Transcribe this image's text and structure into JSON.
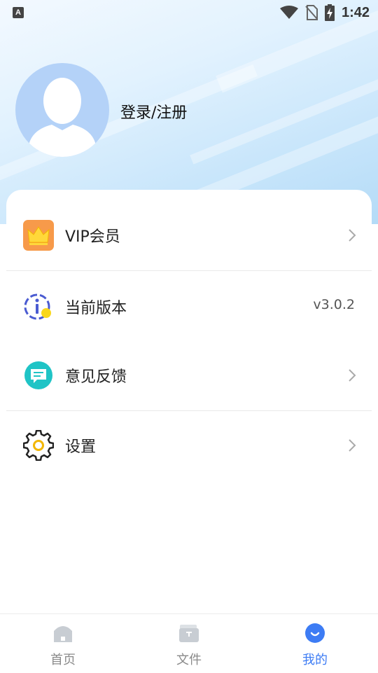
{
  "status_bar": {
    "time": "1:42",
    "app_icon": "A"
  },
  "profile": {
    "login_text": "登录/注册",
    "avatar_icon": "default-avatar-icon"
  },
  "menu": [
    {
      "label": "VIP会员",
      "icon": "crown-icon",
      "trailing": "chevron"
    },
    {
      "label": "当前版本",
      "icon": "info-icon",
      "value": "v3.0.2"
    },
    {
      "label": "意见反馈",
      "icon": "feedback-icon",
      "trailing": "chevron"
    },
    {
      "label": "设置",
      "icon": "gear-icon",
      "trailing": "chevron"
    }
  ],
  "nav": [
    {
      "label": "首页",
      "icon": "home-icon",
      "active": false
    },
    {
      "label": "文件",
      "icon": "folder-icon",
      "active": false
    },
    {
      "label": "我的",
      "icon": "profile-icon",
      "active": true
    }
  ],
  "colors": {
    "accent": "#3d7cf4",
    "vip_orange": "#f79a4a",
    "feedback_teal": "#1fc4c6",
    "gear_yellow": "#f2b705"
  }
}
